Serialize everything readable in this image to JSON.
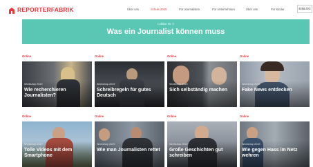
{
  "brand": {
    "name": "REPORTERFABRIK",
    "color": "#e8373f"
  },
  "nav": {
    "items": [
      "Über uns",
      "Schule 2020",
      "Für Journalisten",
      "Für Unternehmen",
      "Über uns",
      "Für Kinder"
    ],
    "active_index": 1,
    "login_label": "EINLOG"
  },
  "banner": {
    "kicker": "Lektion Nr. 3",
    "title": "Was ein Journalist können muss",
    "color": "#5ac7b5"
  },
  "cards": [
    {
      "category": "Online",
      "meta": "Workshop 2019",
      "title": "Wie recherchieren Journalisten?"
    },
    {
      "category": "Online",
      "meta": "Workshop 2019",
      "title": "Schreibregeln für gutes Deutsch"
    },
    {
      "category": "Online",
      "meta": "Workshop 2019",
      "title": "Sich selbständig machen"
    },
    {
      "category": "Online",
      "meta": "Workshop 2019",
      "title": "Fake News entdecken"
    },
    {
      "category": "Online",
      "meta": "Workshop 2019",
      "title": "Tolle Videos mit dem Smartphone"
    },
    {
      "category": "Online",
      "meta": "Workshop 2019",
      "title": "Wie man Journalisten rettet"
    },
    {
      "category": "Online",
      "meta": "Workshop 2019",
      "title": "Große Geschichten gut schreiben"
    },
    {
      "category": "Online",
      "meta": "Workshop 2019",
      "title": "Wie gegen Hass im Netz wehren"
    }
  ]
}
